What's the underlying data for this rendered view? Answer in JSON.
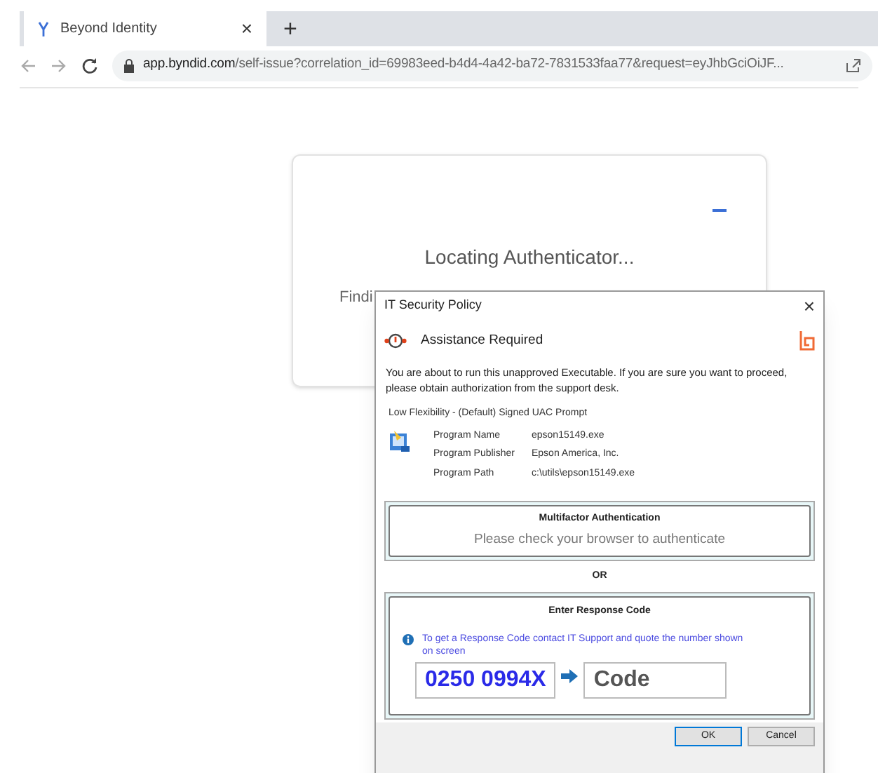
{
  "browser": {
    "tab": {
      "title": "Beyond Identity",
      "close": "×"
    },
    "new_tab": "+",
    "url_host": "app.byndid.com",
    "url_path": "/self-issue?correlation_id=69983eed-b4d4-4a42-ba72-7831533faa77&request=eyJhbGciOiJF..."
  },
  "card": {
    "title": "Locating Authenticator...",
    "text": "Findi"
  },
  "dialog": {
    "title": "IT Security Policy",
    "close": "×",
    "heading": "Assistance Required",
    "message": "You are about to run this unapproved Executable.  If you are sure you want to proceed, please obtain authorization from the support desk.",
    "prompt_type": "Low Flexibility - (Default) Signed UAC Prompt",
    "details": [
      {
        "label": "Program Name",
        "value": "epson15149.exe"
      },
      {
        "label": "Program Publisher",
        "value": "Epson America, Inc."
      },
      {
        "label": "Program Path",
        "value": "c:\\utils\\epson15149.exe"
      }
    ],
    "mfa": {
      "title": "Multifactor Authentication",
      "text": "Please check your browser to authenticate"
    },
    "or": "OR",
    "response": {
      "title": "Enter Response Code",
      "info": "To get a Response Code contact IT Support and quote the number shown on screen",
      "number": "0250 0994X",
      "placeholder": "Code"
    },
    "buttons": [
      {
        "label": "OK",
        "selected": true
      },
      {
        "label": "Cancel",
        "selected": false
      }
    ]
  }
}
